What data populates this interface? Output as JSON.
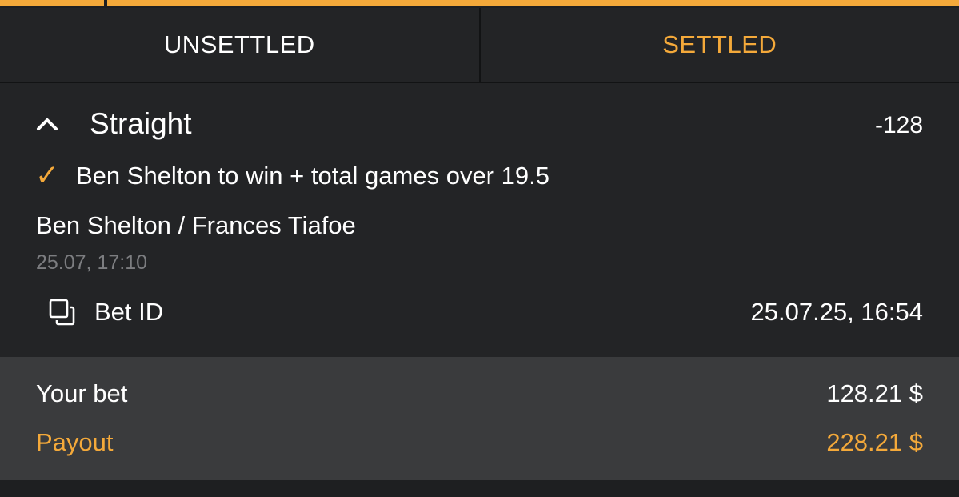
{
  "colors": {
    "accent": "#f4a93a",
    "background": "#232426",
    "summary_background": "#3a3b3d",
    "muted_text": "#7c7d80"
  },
  "tabs": [
    {
      "label": "UNSETTLED",
      "active": false
    },
    {
      "label": "SETTLED",
      "active": true
    }
  ],
  "bet": {
    "collapse_icon": "chevron-up-icon",
    "type": "Straight",
    "odds": "-128",
    "status_icon": "checkmark-icon",
    "selection": "Ben Shelton to win + total games over 19.5",
    "event": "Ben Shelton / Frances Tiafoe",
    "event_time": "25.07, 17:10",
    "bet_id_icon": "copy-icon",
    "bet_id_label": "Bet ID",
    "placed_at": "25.07.25, 16:54"
  },
  "summary": {
    "your_bet_label": "Your bet",
    "your_bet_value": "128.21 $",
    "payout_label": "Payout",
    "payout_value": "228.21 $"
  }
}
